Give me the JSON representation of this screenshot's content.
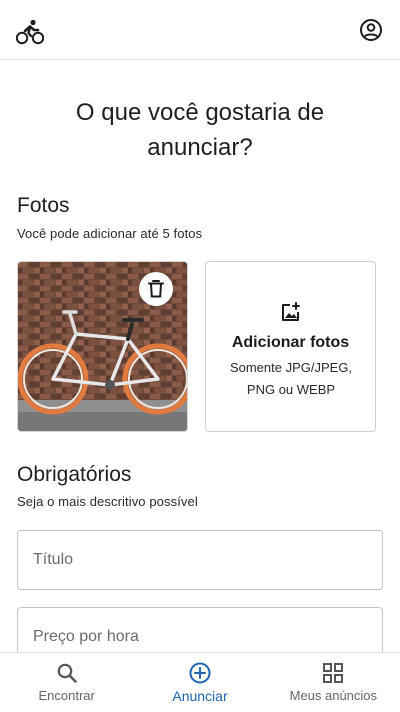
{
  "header": {
    "logo_icon": "cyclist-icon",
    "account_icon": "account-circle-icon"
  },
  "main": {
    "title": "O que você gostaria de anunciar?",
    "photos_section": {
      "title": "Fotos",
      "subtitle": "Você pode adicionar até 5 fotos",
      "photo_icon": "bicycle-photo",
      "delete_icon": "trash-icon",
      "add_card": {
        "icon": "add-photo-icon",
        "title": "Adicionar fotos",
        "subtitle": "Somente JPG/JPEG, PNG ou WEBP"
      }
    },
    "required_section": {
      "title": "Obrigatórios",
      "subtitle": "Seja o mais descritivo possível",
      "fields": [
        {
          "placeholder": "Título",
          "value": ""
        },
        {
          "placeholder": "Preço por hora",
          "value": ""
        }
      ]
    }
  },
  "bottom_nav": {
    "items": [
      {
        "label": "Encontrar",
        "icon": "search-icon",
        "active": false
      },
      {
        "label": "Anunciar",
        "icon": "add-circle-icon",
        "active": true
      },
      {
        "label": "Meus anúncios",
        "icon": "grid-icon",
        "active": false
      }
    ]
  },
  "colors": {
    "accent": "#1f64b3",
    "border": "#c4c4c4",
    "text": "#1c1c1c"
  }
}
